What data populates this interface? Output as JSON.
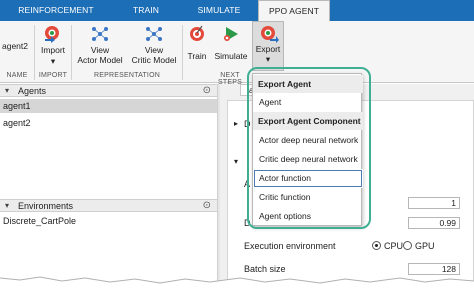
{
  "tabs": [
    {
      "label": "REINFORCEMENT LEARNING",
      "active": false
    },
    {
      "label": "TRAIN",
      "active": false
    },
    {
      "label": "SIMULATE",
      "active": false
    },
    {
      "label": "PPO AGENT",
      "active": true
    }
  ],
  "ribbon": {
    "agent_name": "agent2",
    "import_label": "Import",
    "view_actor_label_1": "View",
    "view_actor_label_2": "Actor Model",
    "view_critic_label_1": "View",
    "view_critic_label_2": "Critic Model",
    "train_label": "Train",
    "simulate_label": "Simulate",
    "export_label": "Export",
    "sections": {
      "name": "NAME",
      "import": "IMPORT",
      "representation": "REPRESENTATION",
      "next_steps": "NEXT STEPS"
    }
  },
  "agents_panel": {
    "title": "Agents",
    "items": [
      "agent1",
      "agent2"
    ],
    "selected_index": 0
  },
  "environments_panel": {
    "title": "Environments",
    "items": [
      "Discrete_CartPole"
    ]
  },
  "doc_area": {
    "tab_label": "agent2",
    "section_letter_1": "D",
    "section_letter_2": "A",
    "field_1_value": "1",
    "label_d": "D",
    "field_2_value": "0.99",
    "execution_environment_label": "Execution environment",
    "cpu_label": "CPU",
    "gpu_label": "GPU",
    "batch_size_label": "Batch size",
    "batch_size_value": "128"
  },
  "export_menu": {
    "header_1": "Export Agent",
    "agent_item": "Agent",
    "header_2": "Export Agent Component",
    "items": [
      "Actor deep neural network",
      "Critic deep neural network",
      "Actor function",
      "Critic function",
      "Agent options"
    ],
    "hover_index": 2
  },
  "colors": {
    "tabbar": "#1c6eb6",
    "highlight": "#3fae93",
    "hover_outline": "#4b7bb5"
  }
}
